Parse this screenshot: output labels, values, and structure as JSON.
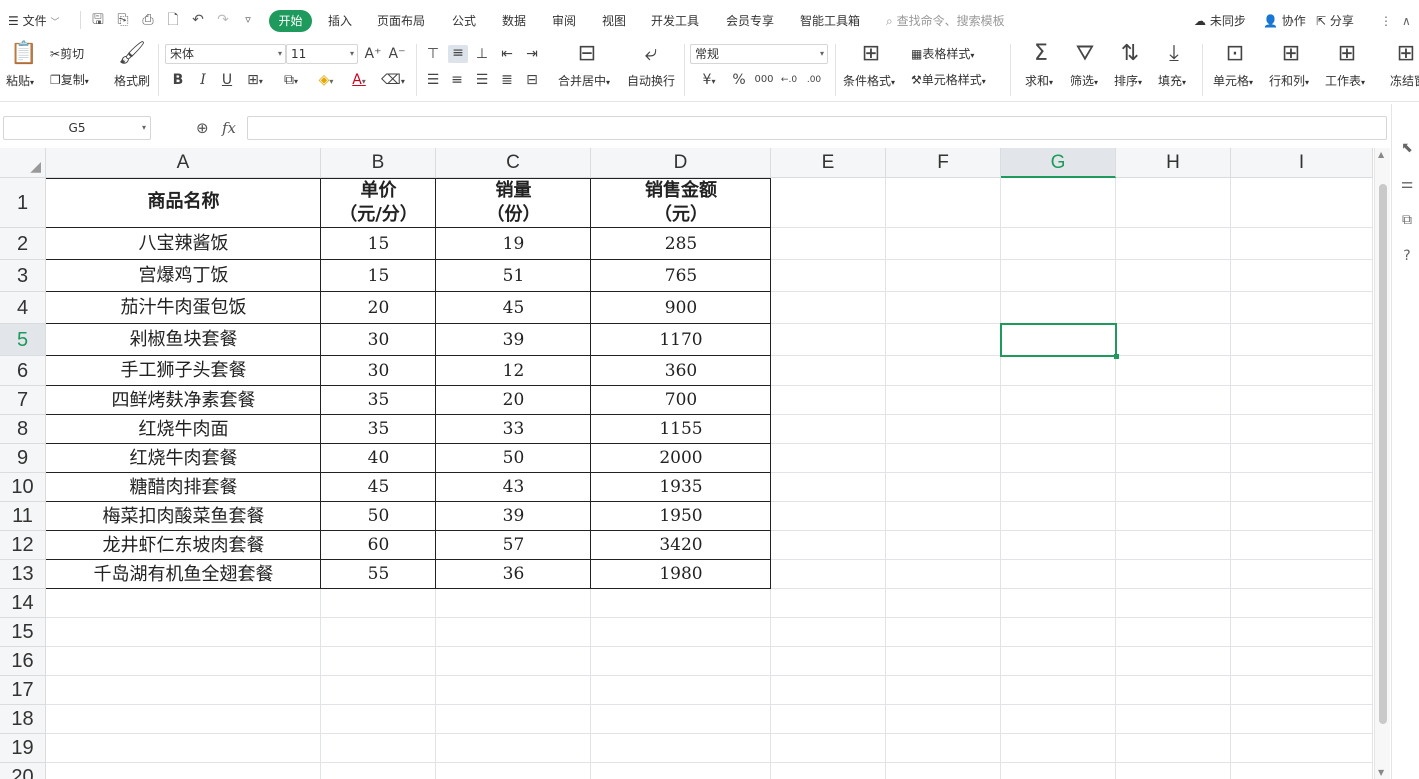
{
  "menubar": {
    "file": "文件",
    "tabs": [
      "开始",
      "插入",
      "页面布局",
      "公式",
      "数据",
      "审阅",
      "视图",
      "开发工具",
      "会员专享",
      "智能工具箱"
    ],
    "search_placeholder": "查找命令、搜索模板",
    "sync": "未同步",
    "collab": "协作",
    "share": "分享"
  },
  "ribbon": {
    "paste": "粘贴",
    "cut": "剪切",
    "copy": "复制",
    "format_painter": "格式刷",
    "font_name": "宋体",
    "font_size": "11",
    "merge_center": "合并居中",
    "wrap_text": "自动换行",
    "number_format": "常规",
    "conditional_format": "条件格式",
    "table_style": "表格样式",
    "cell_style": "单元格样式",
    "sum": "求和",
    "filter": "筛选",
    "sort": "排序",
    "fill": "填充",
    "cell": "单元格",
    "row_col": "行和列",
    "worksheet": "工作表",
    "freeze": "冻结窗"
  },
  "formula_bar": {
    "name_box": "G5",
    "fx": "fx",
    "value": ""
  },
  "sheet": {
    "columns": [
      "A",
      "B",
      "C",
      "D",
      "E",
      "F",
      "G",
      "H",
      "I"
    ],
    "rows": [
      "1",
      "2",
      "3",
      "4",
      "5",
      "6",
      "7",
      "8",
      "9",
      "10",
      "11",
      "12",
      "13",
      "14",
      "15",
      "16",
      "17",
      "18",
      "19",
      "20"
    ],
    "active_cell": "G5",
    "header": [
      "商品名称",
      "单价\n（元/分）",
      "销量\n（份）",
      "销售金额\n（元）"
    ],
    "header_lines": [
      [
        "商品名称"
      ],
      [
        "单价",
        "（元/分）"
      ],
      [
        "销量",
        "（份）"
      ],
      [
        "销售金额",
        "（元）"
      ]
    ],
    "data": [
      [
        "八宝辣酱饭",
        "15",
        "19",
        "285"
      ],
      [
        "宫爆鸡丁饭",
        "15",
        "51",
        "765"
      ],
      [
        "茄汁牛肉蛋包饭",
        "20",
        "45",
        "900"
      ],
      [
        "剁椒鱼块套餐",
        "30",
        "39",
        "1170"
      ],
      [
        "手工狮子头套餐",
        "30",
        "12",
        "360"
      ],
      [
        "四鲜烤麸净素套餐",
        "35",
        "20",
        "700"
      ],
      [
        "红烧牛肉面",
        "35",
        "33",
        "1155"
      ],
      [
        "红烧牛肉套餐",
        "40",
        "50",
        "2000"
      ],
      [
        "糖醋肉排套餐",
        "45",
        "43",
        "1935"
      ],
      [
        "梅菜扣肉酸菜鱼套餐",
        "50",
        "39",
        "1950"
      ],
      [
        "龙井虾仁东坡肉套餐",
        "60",
        "57",
        "3420"
      ],
      [
        "千岛湖有机鱼全翅套餐",
        "55",
        "36",
        "1980"
      ]
    ]
  },
  "colors": {
    "accent": "#1e9a5c"
  }
}
